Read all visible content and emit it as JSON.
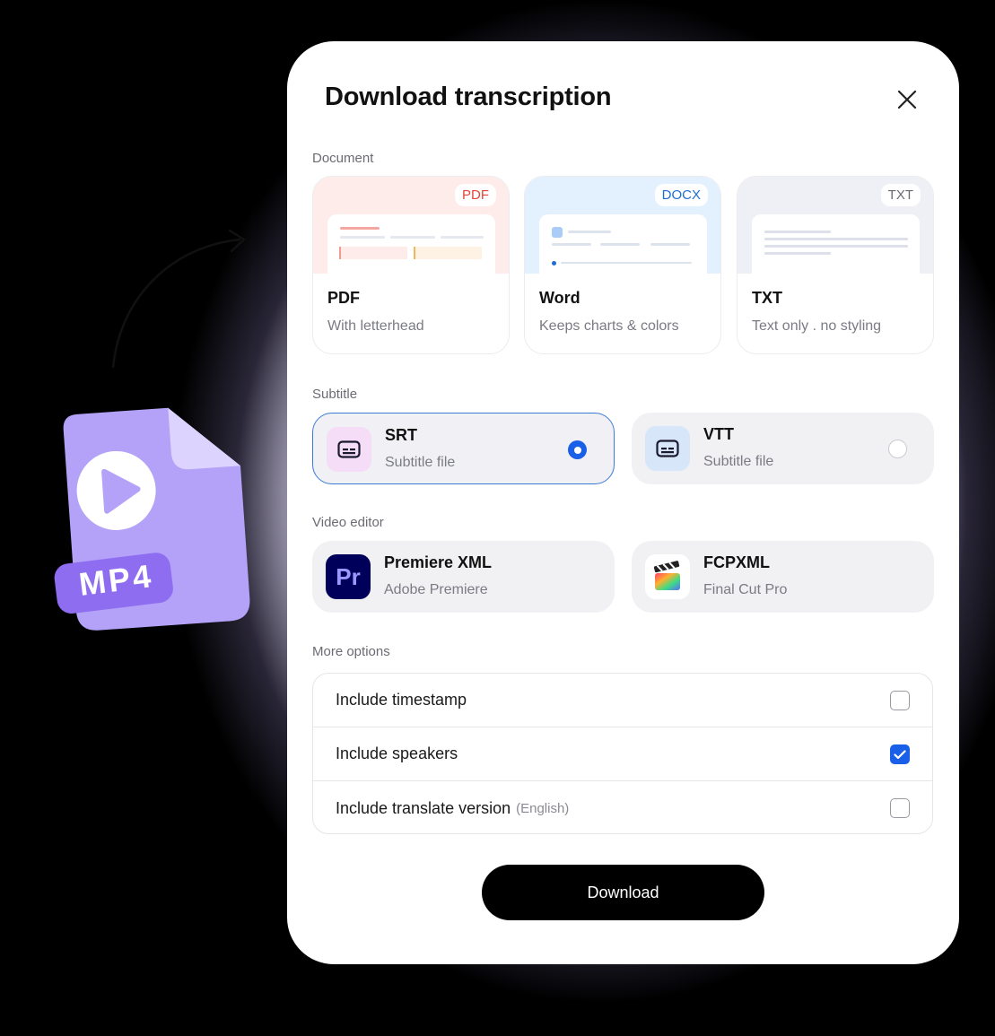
{
  "illustration": {
    "file_label": "MP4"
  },
  "dialog": {
    "title": "Download transcription",
    "sections": {
      "document": "Document",
      "subtitle": "Subtitle",
      "video_editor": "Video editor",
      "more_options": "More options"
    },
    "documents": [
      {
        "badge": "PDF",
        "name": "PDF",
        "desc": "With letterhead",
        "badge_color": "#e0463a",
        "preview_bg": "#fdece9"
      },
      {
        "badge": "DOCX",
        "name": "Word",
        "desc": "Keeps charts & colors",
        "badge_color": "#1f6fd1",
        "preview_bg": "#e3f0fd"
      },
      {
        "badge": "TXT",
        "name": "TXT",
        "desc": "Text only . no styling",
        "badge_color": "#6b6b73",
        "preview_bg": "#eef0f6"
      }
    ],
    "subtitles": [
      {
        "title": "SRT",
        "sub": "Subtitle file",
        "selected": true
      },
      {
        "title": "VTT",
        "sub": "Subtitle file",
        "selected": false
      }
    ],
    "editors": [
      {
        "title": "Premiere XML",
        "sub": "Adobe Premiere",
        "icon_text": "Pr"
      },
      {
        "title": "FCPXML",
        "sub": "Final Cut Pro"
      }
    ],
    "options": [
      {
        "label": "Include timestamp",
        "hint": "",
        "checked": false
      },
      {
        "label": "Include speakers",
        "hint": "",
        "checked": true
      },
      {
        "label": "Include translate version",
        "hint": "(English)",
        "checked": false
      }
    ],
    "download_label": "Download"
  },
  "colors": {
    "accent": "#1a5fe8",
    "premiere_bg": "#00005b",
    "premiere_fg": "#9999ff",
    "mp4_purple": "#b3a2f7"
  }
}
